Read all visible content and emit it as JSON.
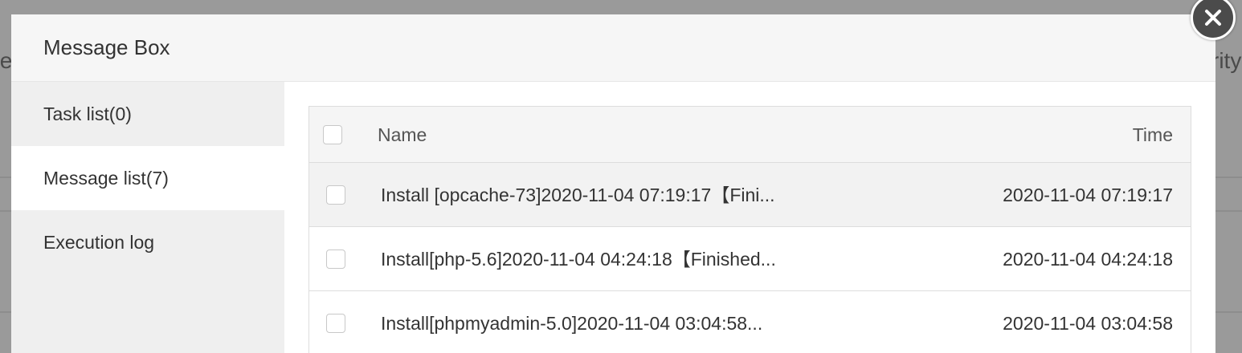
{
  "background": {
    "left_fragment": "te",
    "right_fragment": "rity"
  },
  "dialog": {
    "title": "Message Box",
    "close_icon": "close-icon"
  },
  "sidebar": {
    "items": [
      {
        "label": "Task list(0)",
        "active": false
      },
      {
        "label": "Message list(7)",
        "active": true
      },
      {
        "label": "Execution log",
        "active": false
      }
    ]
  },
  "table": {
    "headers": {
      "name": "Name",
      "time": "Time"
    },
    "rows": [
      {
        "name": "Install [opcache-73]2020-11-04 07:19:17【Fini...",
        "time": "2020-11-04 07:19:17"
      },
      {
        "name": "Install[php-5.6]2020-11-04 04:24:18【Finished...",
        "time": "2020-11-04 04:24:18"
      },
      {
        "name": "Install[phpmyadmin-5.0]2020-11-04 03:04:58...",
        "time": "2020-11-04 03:04:58"
      }
    ]
  },
  "colors": {
    "overlay": "#9a9a9a",
    "active_tab": "#ffffff",
    "sidebar": "#efefef",
    "close_button": "#4b4b4b"
  }
}
